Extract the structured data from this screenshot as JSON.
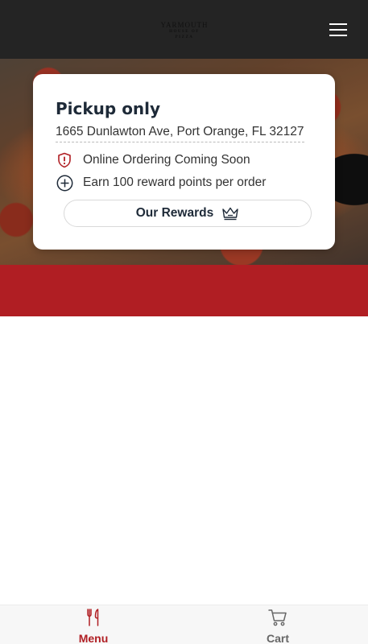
{
  "header": {
    "logo_line1": "YARMOUTH",
    "logo_line2": "HOUSE OF PIZZA",
    "menu_icon": "hamburger-icon"
  },
  "card": {
    "title": "Pickup only",
    "address": "1665 Dunlawton Ave, Port Orange, FL 32127",
    "notices": [
      {
        "icon": "shield-alert-icon",
        "text": "Online Ordering Coming Soon"
      },
      {
        "icon": "plus-circle-icon",
        "text": "Earn 100 reward points per order"
      }
    ],
    "rewards_button": {
      "label": "Our Rewards",
      "icon": "crown-icon"
    }
  },
  "bottom_nav": {
    "items": [
      {
        "label": "Menu",
        "icon": "fork-knife-icon",
        "active": true
      },
      {
        "label": "Cart",
        "icon": "cart-icon",
        "active": false
      }
    ]
  },
  "colors": {
    "header_bg": "#242424",
    "accent_red": "#b01e23",
    "title_navy": "#1e2a38"
  }
}
